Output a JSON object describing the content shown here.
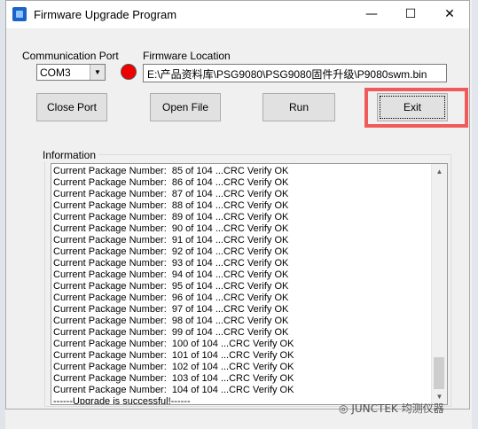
{
  "window": {
    "title": "Firmware Upgrade Program",
    "minimize_glyph": "—",
    "maximize_glyph": "☐",
    "close_glyph": "✕"
  },
  "comm_port": {
    "label": "Communication Port",
    "value": "COM3"
  },
  "firmware": {
    "label": "Firmware Location",
    "path": "E:\\产品资料库\\PSG9080\\PSG9080固件升级\\P9080swm.bin"
  },
  "status_led": {
    "color": "#ee0000"
  },
  "buttons": {
    "close_port": "Close Port",
    "open_file": "Open File",
    "run": "Run",
    "exit": "Exit"
  },
  "info": {
    "label": "Information",
    "lines": [
      "Current Package Number:  85 of 104 ...CRC Verify OK",
      "Current Package Number:  86 of 104 ...CRC Verify OK",
      "Current Package Number:  87 of 104 ...CRC Verify OK",
      "Current Package Number:  88 of 104 ...CRC Verify OK",
      "Current Package Number:  89 of 104 ...CRC Verify OK",
      "Current Package Number:  90 of 104 ...CRC Verify OK",
      "Current Package Number:  91 of 104 ...CRC Verify OK",
      "Current Package Number:  92 of 104 ...CRC Verify OK",
      "Current Package Number:  93 of 104 ...CRC Verify OK",
      "Current Package Number:  94 of 104 ...CRC Verify OK",
      "Current Package Number:  95 of 104 ...CRC Verify OK",
      "Current Package Number:  96 of 104 ...CRC Verify OK",
      "Current Package Number:  97 of 104 ...CRC Verify OK",
      "Current Package Number:  98 of 104 ...CRC Verify OK",
      "Current Package Number:  99 of 104 ...CRC Verify OK",
      "Current Package Number:  100 of 104 ...CRC Verify OK",
      "Current Package Number:  101 of 104 ...CRC Verify OK",
      "Current Package Number:  102 of 104 ...CRC Verify OK",
      "Current Package Number:  103 of 104 ...CRC Verify OK",
      "Current Package Number:  104 of 104 ...CRC Verify OK",
      "------Upgrade is successful!------"
    ]
  },
  "watermark": "JUNCTEK 均测仪器",
  "highlight_color": "#f05a5a"
}
